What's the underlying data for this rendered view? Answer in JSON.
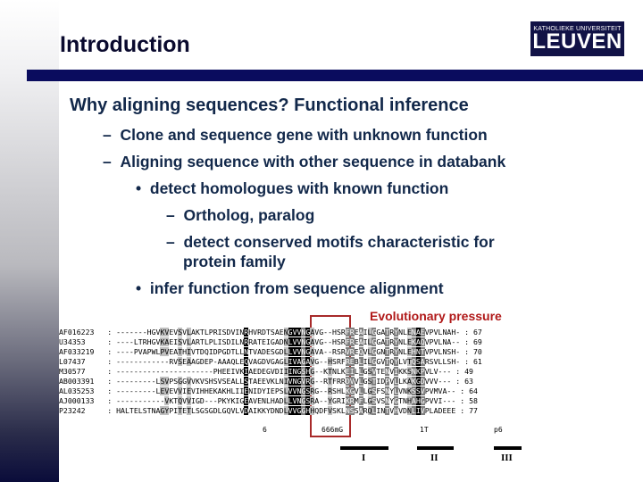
{
  "slide": {
    "title": "Introduction",
    "logo": {
      "line1": "KATHOLIEKE UNIVERSITEIT",
      "line2": "LEUVEN"
    },
    "heading": "Why aligning sequences? Functional inference",
    "bullets": [
      {
        "marker": "–",
        "text": "Clone and sequence gene with unknown function"
      },
      {
        "marker": "–",
        "text": "Aligning sequence with other sequence in databank"
      },
      {
        "marker": "•",
        "text": "detect homologues with known function"
      },
      {
        "marker": "–",
        "text": "Ortholog, paralog"
      },
      {
        "marker": "–",
        "text": "detect conserved motifs characteristic for"
      },
      {
        "marker": "",
        "text": "protein family"
      },
      {
        "marker": "•",
        "text": "infer function from sequence alignment"
      }
    ]
  },
  "alignment": {
    "annotation": "Evolutionary pressure",
    "rows": [
      {
        "id": "AF016223",
        "seq": "-------HGVKVEVSVLAKTLPRISDVINRHVRDTSAENGVVNGAVG--HSRFREAILGGATRYNLENAEVPVLNAH-",
        "len": "67"
      },
      {
        "id": "U34353",
        "seq": "----LTRHGVKAEISVLARTLPLISDILNRRATEIGADNLVVNGAVG--HSRFREAILGGATRYNLEKAQVPVLNA--",
        "len": "69"
      },
      {
        "id": "AF033219",
        "seq": "----PVAPWLPVEATHIVTDQIDPGDTLLNTVADESGDLLVVNGAVA--RSRVREQVLGGNTRYNLEHNTVPVLNSH-",
        "len": "70"
      },
      {
        "id": "L07437",
        "seq": "------------RVSEAAGDEP-AAAQLEQVAGDVGAGLIVAGAVG--HSRFREBLILGGVTQYLVTQSARSVLLSH-",
        "len": "61"
      },
      {
        "id": "M30577",
        "seq": "----------------------PHEEIVKIAEDEGVDIIINGSHG--KTNLKEILLGSVTENVIKKSNKPVLV---",
        "len": "49"
      },
      {
        "id": "AB003391",
        "seq": "---------LSVPSGGVVKVSHSVSEALLSTAEEVKLNIVNGVRG--RTFRRDVVLGSTIDPVLLKAKGDVVV---",
        "len": "63"
      },
      {
        "id": "AL035253",
        "seq": "---------LEVEVVIEVIHHEKAKHLIIENIDYIEPSLVVNGSRG--RSHLKGVLLGSFSNYLVNKSSVPVMVA--",
        "len": "64"
      },
      {
        "id": "AJ000133",
        "seq": "-----------VKTQVVIGD---PKYKIGEAVENLHADLLVNGSRA--YGRIKRMFLGSVSNYGTNHAHGPVVI---",
        "len": "58"
      },
      {
        "id": "P23242",
        "seq": "HALTELSTNAGYPITETLSGSGDLGQVLVDAIKKYDNDLVVGGHHQDFVSKLNSSARQLINTVHVDNLIVPLADEEE",
        "len": "77"
      }
    ],
    "position_labels": [
      "6",
      "666mG",
      "1T",
      "p6"
    ],
    "motifs": [
      "I",
      "II",
      "III"
    ]
  }
}
